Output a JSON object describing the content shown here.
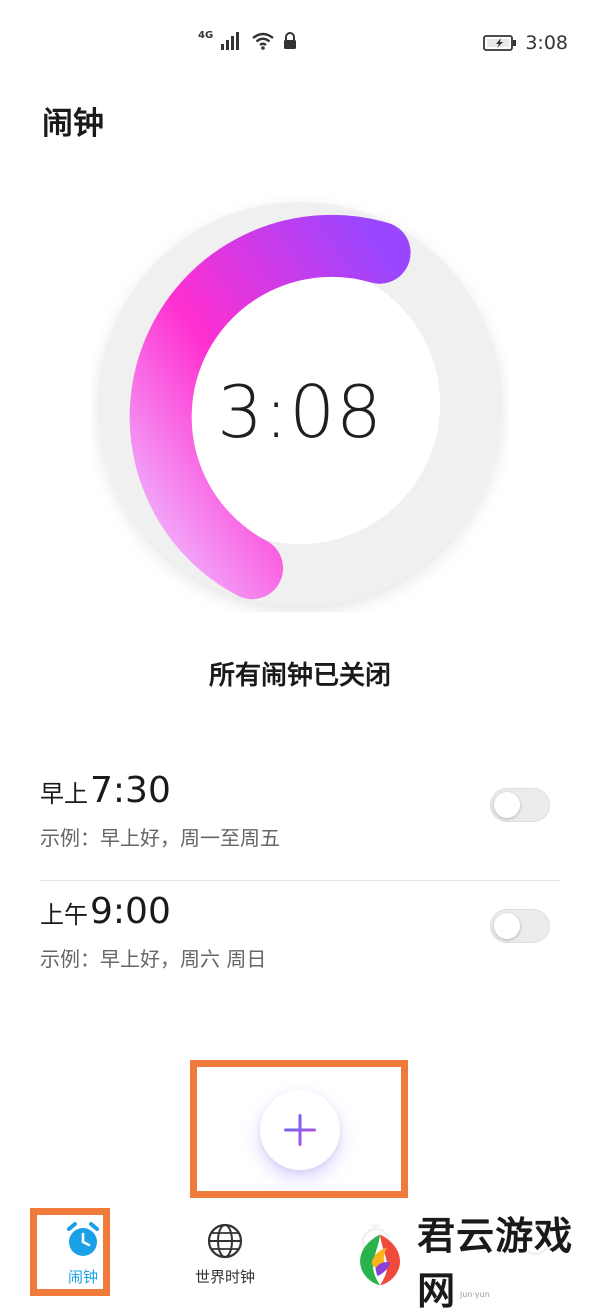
{
  "status_bar": {
    "network": "4G",
    "time": "3:08"
  },
  "page": {
    "title": "闹钟"
  },
  "clock": {
    "time": "3:08",
    "gradient_start": "#f0b8ff",
    "gradient_mid": "#ff2fd0",
    "gradient_end": "#9a46ff"
  },
  "alarm_status": "所有闹钟已关闭",
  "alarms": [
    {
      "period": "早上",
      "time": "7:30",
      "description": "示例：早上好，周一至周五",
      "enabled": false
    },
    {
      "period": "上午",
      "time": "9:00",
      "description": "示例：早上好，周六 周日",
      "enabled": false
    }
  ],
  "add_button": {
    "icon": "plus-icon",
    "accent": "#7a5cff"
  },
  "bottom_nav": {
    "items": [
      {
        "label": "闹钟",
        "icon": "alarm-clock-icon",
        "active": true
      },
      {
        "label": "世界时钟",
        "icon": "globe-icon",
        "active": false
      },
      {
        "label": "",
        "icon": "stopwatch-icon",
        "active": false
      },
      {
        "label": "",
        "icon": "timer-icon",
        "active": false
      }
    ],
    "active_color": "#1aa0e6",
    "highlight_color": "#f07a3c"
  },
  "watermark": {
    "text": "君云游戏网",
    "subtext": "jun·yun"
  }
}
